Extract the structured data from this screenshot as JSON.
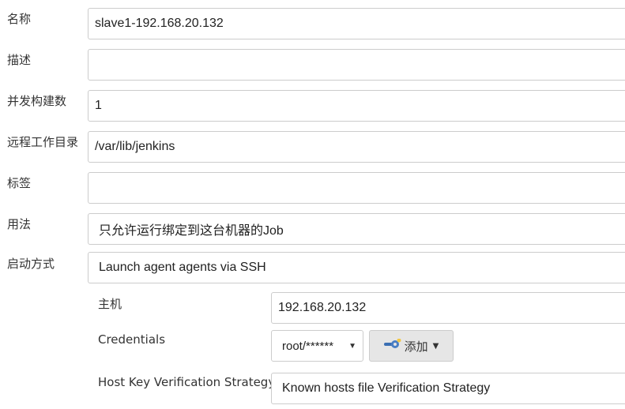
{
  "form": {
    "name": {
      "label": "名称",
      "value": "slave1-192.168.20.132"
    },
    "description": {
      "label": "描述",
      "value": ""
    },
    "executors": {
      "label": "并发构建数",
      "value": "1"
    },
    "remote_dir": {
      "label": "远程工作目录",
      "value": "/var/lib/jenkins"
    },
    "labels": {
      "label": "标签",
      "value": ""
    },
    "usage": {
      "label": "用法",
      "selected": "只允许运行绑定到这台机器的Job"
    },
    "launch": {
      "label": "启动方式",
      "selected": "Launch agent agents via SSH"
    }
  },
  "ssh": {
    "host": {
      "label": "主机",
      "value": "192.168.20.132"
    },
    "credentials": {
      "label": "Credentials",
      "selected": "root/******",
      "add_label": "添加"
    },
    "host_key": {
      "label": "Host Key Verification Strategy",
      "selected": "Known hosts file Verification Strategy"
    }
  },
  "icons": {
    "add": "key-icon",
    "dropdown": "caret-down-icon"
  }
}
